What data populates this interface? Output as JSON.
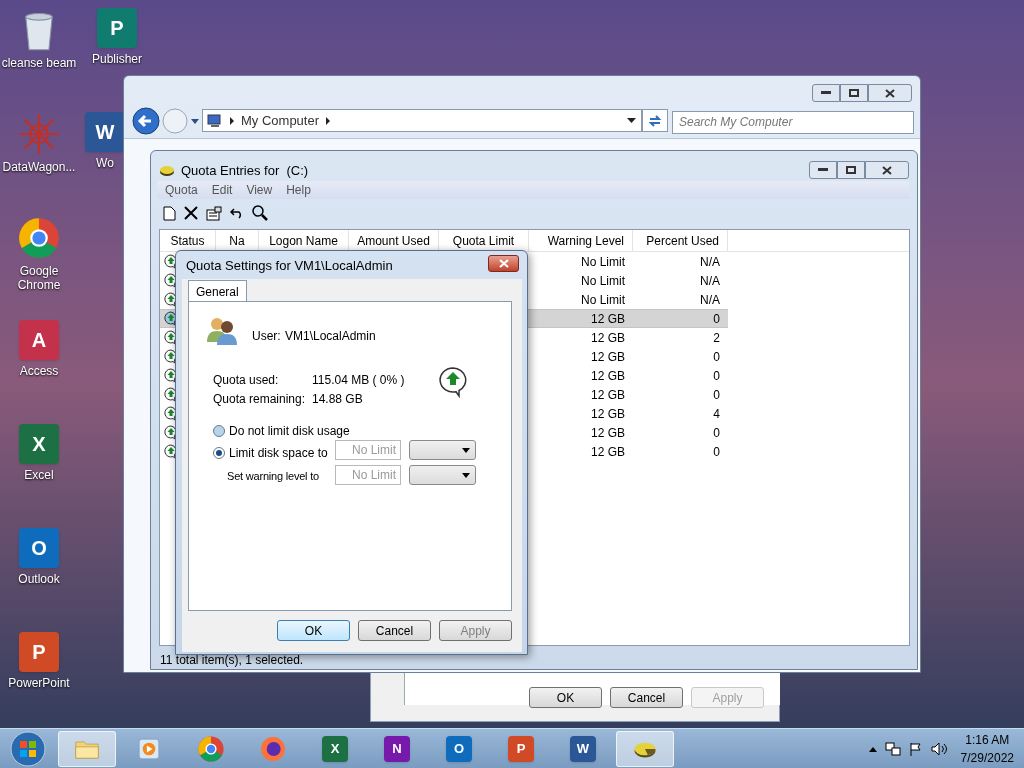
{
  "desktop_icons": [
    {
      "label": "cleanse beam",
      "kind": "recycle"
    },
    {
      "label": "Publisher",
      "kind": "office",
      "letter": "P",
      "color": "#107c6f"
    },
    {
      "label": "DataWagon...",
      "kind": "datawagon"
    },
    {
      "label": "Wo",
      "kind": "office",
      "letter": "W",
      "color": "#2b5797"
    },
    {
      "label": "Google Chrome",
      "kind": "chrome"
    },
    {
      "label": "Access",
      "kind": "office",
      "letter": "A",
      "color": "#c4314b"
    },
    {
      "label": "Excel",
      "kind": "office",
      "letter": "X",
      "color": "#1d7044"
    },
    {
      "label": "Outlook",
      "kind": "office",
      "letter": "O",
      "color": "#0f6cbd"
    },
    {
      "label": "PowerPoint",
      "kind": "office",
      "letter": "P",
      "color": "#d04a25"
    }
  ],
  "back_dialog": {
    "buttons": [
      {
        "label": "OK",
        "disabled": false
      },
      {
        "label": "Cancel",
        "disabled": false
      },
      {
        "label": "Apply",
        "disabled": true
      }
    ]
  },
  "explorer": {
    "address": "My Computer",
    "search_placeholder": "Search My Computer"
  },
  "quota_window": {
    "title": "Quota Entries for  (C:)",
    "menu": [
      "Quota",
      "Edit",
      "View",
      "Help"
    ],
    "columns": [
      "Status",
      "Na",
      "Logon Name",
      "Amount Used",
      "Quota Limit",
      "Warning Level",
      "Percent Used"
    ],
    "rows": [
      {
        "warning_level": "No Limit",
        "percent_used": "N/A",
        "selected": false
      },
      {
        "warning_level": "No Limit",
        "percent_used": "N/A",
        "selected": false
      },
      {
        "warning_level": "No Limit",
        "percent_used": "N/A",
        "selected": false
      },
      {
        "warning_level": "12 GB",
        "percent_used": "0",
        "selected": true
      },
      {
        "warning_level": "12 GB",
        "percent_used": "2",
        "selected": false
      },
      {
        "warning_level": "12 GB",
        "percent_used": "0",
        "selected": false
      },
      {
        "warning_level": "12 GB",
        "percent_used": "0",
        "selected": false
      },
      {
        "warning_level": "12 GB",
        "percent_used": "0",
        "selected": false
      },
      {
        "warning_level": "12 GB",
        "percent_used": "4",
        "selected": false
      },
      {
        "warning_level": "12 GB",
        "percent_used": "0",
        "selected": false
      },
      {
        "warning_level": "12 GB",
        "percent_used": "0",
        "selected": false
      }
    ],
    "status_bar": "11 total item(s), 1 selected."
  },
  "dialog": {
    "title": "Quota Settings for VM1\\LocalAdmin",
    "tabs": [
      {
        "label": "General",
        "selected": true
      }
    ],
    "user_label": "User:",
    "user": "VM1\\LocalAdmin",
    "quota_used_label": "Quota used:",
    "quota_used": "115.04 MB ( 0% )",
    "quota_remaining_label": "Quota remaining:",
    "quota_remaining": "14.88 GB",
    "options": [
      {
        "label": "Do not limit disk usage",
        "selected": false
      },
      {
        "label": "Limit disk space to",
        "selected": true
      }
    ],
    "limit_value": "No Limit",
    "warning_label": "Set warning level to",
    "warning_value": "No Limit",
    "buttons": [
      {
        "label": "OK",
        "disabled": false,
        "default": true
      },
      {
        "label": "Cancel",
        "disabled": false,
        "default": false
      },
      {
        "label": "Apply",
        "disabled": true,
        "default": false
      }
    ]
  },
  "taskbar": {
    "items": [
      {
        "kind": "explorer",
        "active": true
      },
      {
        "kind": "media",
        "active": false
      },
      {
        "kind": "chrome",
        "active": false
      },
      {
        "kind": "firefox",
        "active": false
      },
      {
        "kind": "office",
        "letter": "X",
        "color": "#1d7044",
        "active": false
      },
      {
        "kind": "office",
        "letter": "N",
        "color": "#7719aa",
        "active": false
      },
      {
        "kind": "office",
        "letter": "O",
        "color": "#0f6cbd",
        "active": false
      },
      {
        "kind": "office",
        "letter": "P",
        "color": "#d04a25",
        "active": false
      },
      {
        "kind": "office",
        "letter": "W",
        "color": "#2b5797",
        "active": false
      },
      {
        "kind": "quota",
        "active": true
      }
    ],
    "time": "1:16 AM",
    "date": "7/29/2022"
  }
}
